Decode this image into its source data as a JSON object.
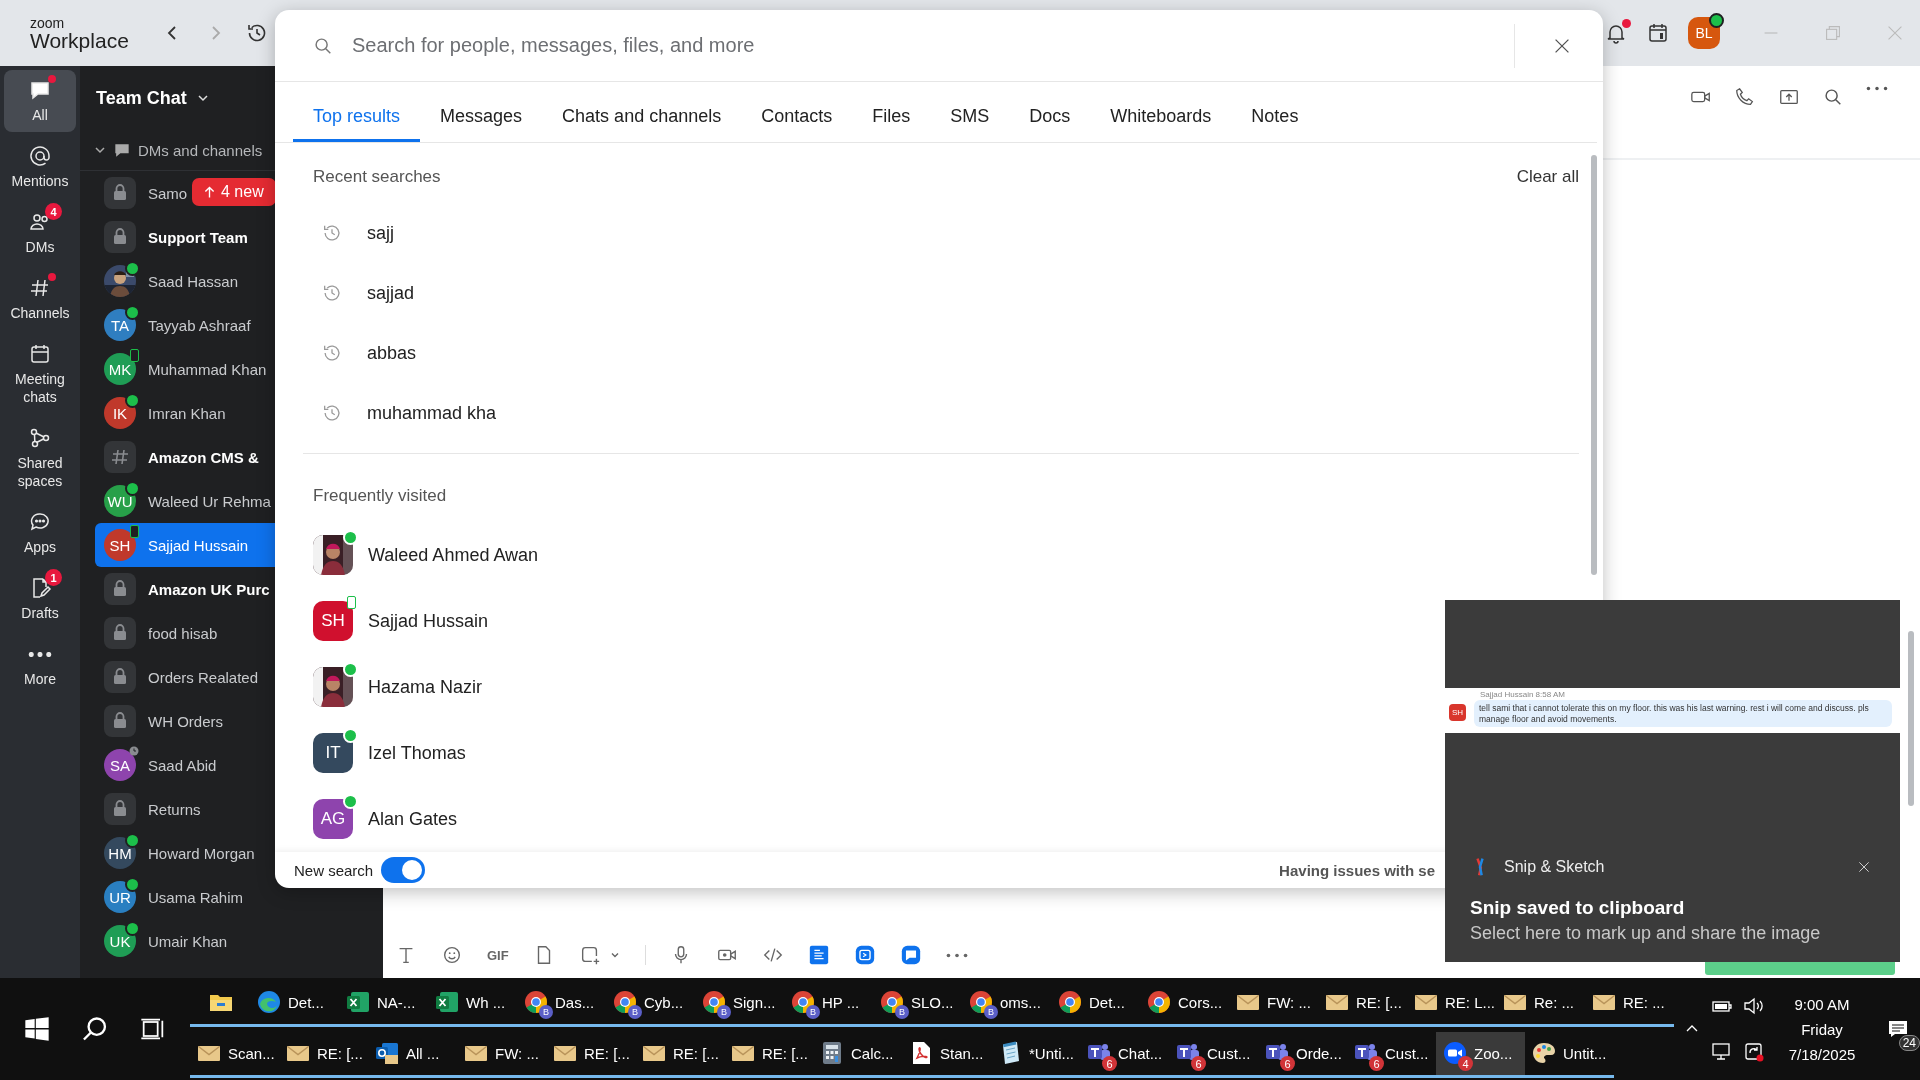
{
  "title_bar": {
    "brand": "zoom",
    "product": "Workplace",
    "bell_unread": true,
    "avatar": {
      "initials": "BL",
      "online": true
    }
  },
  "nav": [
    {
      "label": "All",
      "kind": "chat",
      "selected": true,
      "dot": true
    },
    {
      "label": "Mentions",
      "kind": "at",
      "selected": false,
      "dot": false
    },
    {
      "label": "DMs",
      "kind": "people",
      "selected": false,
      "dot": false,
      "badge": "4"
    },
    {
      "label": "Channels",
      "kind": "hash",
      "selected": false,
      "dot": true
    },
    {
      "label": "Meeting chats",
      "kind": "calendar",
      "selected": false,
      "dot": false
    },
    {
      "label": "Shared spaces",
      "kind": "share",
      "selected": false,
      "dot": false
    },
    {
      "label": "Apps",
      "kind": "apps",
      "selected": false,
      "dot": false
    },
    {
      "label": "Drafts",
      "kind": "drafts",
      "selected": false,
      "dot": false,
      "badge": "1"
    },
    {
      "label": "More",
      "kind": "more",
      "selected": false,
      "dot": false
    }
  ],
  "channels": {
    "title": "Team Chat",
    "section": "DMs and channels",
    "new_badge": "4 new",
    "items": [
      {
        "name": "Samo",
        "kind": "lock",
        "online": false,
        "mobile": false,
        "away": false,
        "unread": false,
        "selected": false
      },
      {
        "name": "Support Team",
        "kind": "lock",
        "online": false,
        "mobile": false,
        "away": false,
        "unread": true,
        "selected": false
      },
      {
        "name": "Saad Hassan",
        "online": true,
        "mobile": false,
        "away": false,
        "unread": false,
        "selected": false
      },
      {
        "name": "Tayyab Ashraaf",
        "kind": "avatar",
        "initials": "TA",
        "color": "#2f7ec0",
        "online": true,
        "mobile": false,
        "away": false,
        "unread": false,
        "selected": false
      },
      {
        "name": "Muhammad Khan",
        "kind": "avatar",
        "initials": "MK",
        "color": "#1f9d55",
        "online": false,
        "mobile": true,
        "away": false,
        "unread": false,
        "selected": false
      },
      {
        "name": "Imran Khan",
        "kind": "avatar",
        "initials": "IK",
        "color": "#c0392b",
        "online": true,
        "mobile": false,
        "away": false,
        "unread": false,
        "selected": false
      },
      {
        "name": "Amazon CMS &",
        "kind": "hash",
        "online": false,
        "mobile": false,
        "away": false,
        "unread": true,
        "selected": false
      },
      {
        "name": "Waleed Ur Rehma",
        "kind": "avatar",
        "initials": "WU",
        "color": "#27a049",
        "online": true,
        "mobile": false,
        "away": false,
        "unread": false,
        "selected": false
      },
      {
        "name": "Sajjad Hussain",
        "kind": "avatar",
        "initials": "SH",
        "color": "#c0392b",
        "online": false,
        "mobile": true,
        "away": false,
        "unread": false,
        "selected": true
      },
      {
        "name": "Amazon UK Purc",
        "kind": "lock",
        "online": false,
        "mobile": false,
        "away": false,
        "unread": true,
        "selected": false
      },
      {
        "name": "food hisab",
        "kind": "lock",
        "online": false,
        "mobile": false,
        "away": false,
        "unread": false,
        "selected": false
      },
      {
        "name": "Orders Realated",
        "kind": "lock",
        "online": false,
        "mobile": false,
        "away": false,
        "unread": false,
        "selected": false
      },
      {
        "name": "WH Orders",
        "kind": "lock",
        "online": false,
        "mobile": false,
        "away": false,
        "unread": false,
        "selected": false
      },
      {
        "name": "Saad Abid",
        "kind": "avatar",
        "initials": "SA",
        "color": "#8e44ad",
        "online": false,
        "mobile": false,
        "away": true,
        "unread": false,
        "selected": false
      },
      {
        "name": "Returns",
        "kind": "lock",
        "online": false,
        "mobile": false,
        "away": false,
        "unread": false,
        "selected": false
      },
      {
        "name": "Howard Morgan",
        "kind": "avatar",
        "initials": "HM",
        "color": "#34495e",
        "online": true,
        "mobile": false,
        "away": false,
        "unread": false,
        "selected": false
      },
      {
        "name": "Usama Rahim",
        "kind": "avatar",
        "initials": "UR",
        "color": "#2a7fc1",
        "online": true,
        "mobile": false,
        "away": false,
        "unread": false,
        "selected": false
      },
      {
        "name": "Umair Khan",
        "kind": "avatar",
        "initials": "UK",
        "color": "#1f9d55",
        "online": true,
        "mobile": false,
        "away": false,
        "unread": false,
        "selected": false
      }
    ]
  },
  "search": {
    "placeholder": "Search for people, messages, files, and more",
    "tabs": [
      {
        "label": "Top results",
        "selected": true
      },
      {
        "label": "Messages",
        "selected": false
      },
      {
        "label": "Chats and channels",
        "selected": false
      },
      {
        "label": "Contacts",
        "selected": false
      },
      {
        "label": "Files",
        "selected": false
      },
      {
        "label": "SMS",
        "selected": false
      },
      {
        "label": "Docs",
        "selected": false
      },
      {
        "label": "Whiteboards",
        "selected": false
      },
      {
        "label": "Notes",
        "selected": false
      }
    ],
    "recent_title": "Recent searches",
    "clear_label": "Clear all",
    "recent": [
      "sajj",
      "sajjad",
      "abbas",
      "muhammad kha"
    ],
    "frequent_title": "Frequently visited",
    "frequent": [
      {
        "name": "Waleed Ahmed Awan",
        "online": true,
        "mobile": false
      },
      {
        "name": "Sajjad Hussain",
        "kind": "avatar",
        "initials": "SH",
        "color": "#d0102e",
        "online": false,
        "mobile": true
      },
      {
        "name": "Hazama Nazir",
        "online": true,
        "mobile": false
      },
      {
        "name": "Izel Thomas",
        "kind": "avatar",
        "initials": "IT",
        "color": "#34495e",
        "online": true,
        "mobile": false
      },
      {
        "name": "Alan Gates",
        "kind": "avatar",
        "initials": "AG",
        "color": "#8e44ad",
        "online": true,
        "mobile": false
      }
    ],
    "toggle_label": "New search",
    "toggle_on": true,
    "help": "Having issues with se"
  },
  "compose": {
    "gif": "GIF"
  },
  "toast": {
    "app": "Snip & Sketch",
    "title": "Snip saved to clipboard",
    "body": "Select here to mark up and share the image",
    "snip": {
      "initials": "SH",
      "sender": "Sajjad Hussain  8:58 AM",
      "message": "tell sami that i cannot tolerate this on my floor. this was his last warning. rest i will come and discuss. pls manage floor and avoid movements."
    }
  },
  "taskbar": {
    "rows": [
      [
        {
          "kind": "explorer",
          "active": false
        },
        {
          "kind": "edge",
          "label": "Det...",
          "active": false
        },
        {
          "kind": "excel",
          "label": "NA-...",
          "active": false
        },
        {
          "kind": "excel",
          "label": "Wh ...",
          "active": false
        },
        {
          "kind": "chrome",
          "label": "Das...",
          "profile": "B",
          "active": false
        },
        {
          "kind": "chrome",
          "label": "Cyb...",
          "profile": "B",
          "active": false
        },
        {
          "kind": "chrome",
          "label": "Sign...",
          "profile": "B",
          "active": false
        },
        {
          "kind": "chrome",
          "label": "HP ...",
          "profile": "B",
          "active": false
        },
        {
          "kind": "chrome",
          "label": "SLO...",
          "profile": "B",
          "active": false
        },
        {
          "kind": "chrome",
          "label": "oms...",
          "profile": "B",
          "active": false
        },
        {
          "kind": "chrome",
          "label": "Det...",
          "active": false
        },
        {
          "kind": "chrome",
          "label": "Cors...",
          "active": false
        },
        {
          "kind": "mail",
          "label": "FW: ...",
          "active": false
        },
        {
          "kind": "mail",
          "label": "RE: [...",
          "active": false
        },
        {
          "kind": "mail",
          "label": "RE: L...",
          "active": false
        },
        {
          "kind": "mail",
          "label": "Re: ...",
          "active": false
        },
        {
          "kind": "mail",
          "label": "RE: ...",
          "active": false
        }
      ],
      [
        {
          "kind": "mail",
          "label": "Scan...",
          "active": false
        },
        {
          "kind": "mail",
          "label": "RE: [...",
          "active": false
        },
        {
          "kind": "outlook",
          "label": "All ...",
          "active": false
        },
        {
          "kind": "mail",
          "label": "FW: ...",
          "active": false
        },
        {
          "kind": "mail",
          "label": "RE: [...",
          "active": false
        },
        {
          "kind": "mail",
          "label": "RE: [...",
          "active": false
        },
        {
          "kind": "mail",
          "label": "RE: [...",
          "active": false
        },
        {
          "kind": "calc",
          "label": "Calc...",
          "active": false
        },
        {
          "kind": "pdf",
          "label": "Stan...",
          "active": false
        },
        {
          "kind": "notepad",
          "label": "*Unti...",
          "active": false
        },
        {
          "kind": "teams",
          "label": "Chat...",
          "badge": "6",
          "active": false
        },
        {
          "kind": "teams",
          "label": "Cust...",
          "badge": "6",
          "active": false
        },
        {
          "kind": "teams",
          "label": "Orde...",
          "badge": "6",
          "active": false
        },
        {
          "kind": "teams",
          "label": "Cust...",
          "badge": "6",
          "active": false
        },
        {
          "kind": "zoom",
          "label": "Zoo...",
          "badge": "4",
          "active": true
        },
        {
          "kind": "paint",
          "label": "Untit...",
          "active": false
        }
      ]
    ],
    "tray": {
      "time": "9:00 AM",
      "day": "Friday",
      "date": "7/18/2025",
      "notifications": "24"
    }
  }
}
